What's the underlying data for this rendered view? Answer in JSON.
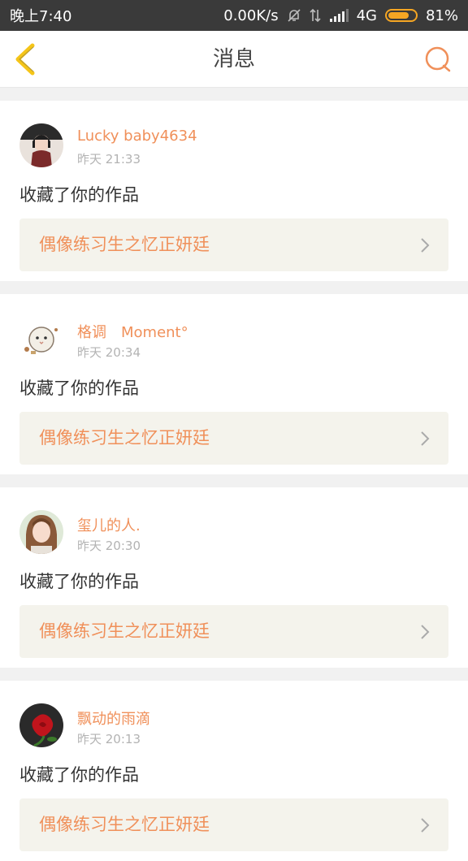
{
  "status_bar": {
    "time": "晚上7:40",
    "speed": "0.00K/s",
    "network": "4G",
    "battery": "81%",
    "battery_level": 0.81,
    "icons": [
      "bell-off-icon",
      "data-arrows-icon",
      "signal-icon",
      "battery-icon"
    ]
  },
  "header": {
    "title": "消息",
    "back_icon": "chevron-left-icon",
    "search_icon": "search-icon"
  },
  "colors": {
    "accent": "#f0905a",
    "back_icon": "#f5c518",
    "card_bg": "#f4f3ec",
    "separator": "#f1f1f1"
  },
  "messages": [
    {
      "user": "Lucky baby4634",
      "time": "昨天 21:33",
      "action": "收藏了你的作品",
      "work": "偶像练习生之忆正妍廷"
    },
    {
      "user": "格调　Moment°",
      "time": "昨天 20:34",
      "action": "收藏了你的作品",
      "work": "偶像练习生之忆正妍廷"
    },
    {
      "user": "玺儿的人.",
      "time": "昨天 20:30",
      "action": "收藏了你的作品",
      "work": "偶像练习生之忆正妍廷"
    },
    {
      "user": "飘动的雨滴",
      "time": "昨天 20:13",
      "action": "收藏了你的作品",
      "work": "偶像练习生之忆正妍廷"
    }
  ]
}
